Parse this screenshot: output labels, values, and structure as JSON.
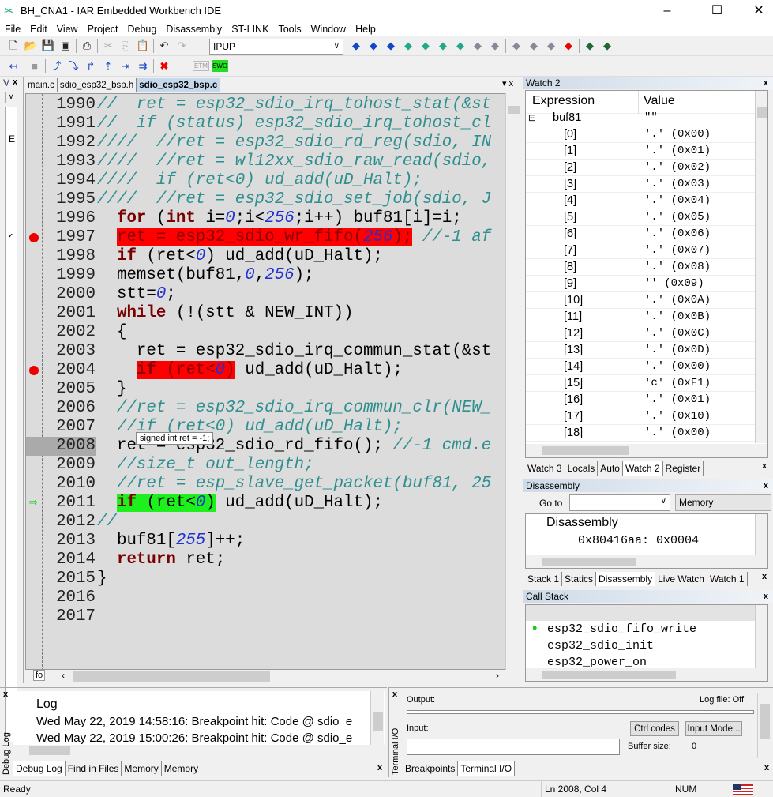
{
  "window": {
    "title": "BH_CNA1 - IAR Embedded Workbench IDE",
    "minimize": "–",
    "maximize": "☐",
    "close": "✕"
  },
  "menu": [
    "File",
    "Edit",
    "View",
    "Project",
    "Debug",
    "Disassembly",
    "ST-LINK",
    "Tools",
    "Window",
    "Help"
  ],
  "toolbar": {
    "configuration": "IPUP",
    "icons1": [
      "new-file",
      "open",
      "save",
      "save-all",
      "print",
      "cut",
      "copy",
      "paste",
      "undo",
      "redo"
    ],
    "icons2": [
      "toggle-breakpoint",
      "find-next",
      "find-prev",
      "go-to-bookmark",
      "template",
      "make",
      "debug-download",
      "debug-without-download",
      "stop-build",
      "step-into-disasm",
      "step-out-disasm",
      "breakpoint-remove",
      "breakpoint",
      "run-to-cursor",
      "go"
    ],
    "debug_icons": [
      "reset",
      "break",
      "step-over",
      "step-into",
      "step-out",
      "next-statement",
      "run-to-cursor",
      "go",
      "stop-debugging"
    ],
    "etm_label": "ETM",
    "swo_label": "SWO"
  },
  "left_pane": {
    "title": "V",
    "close": "x"
  },
  "editor": {
    "tabs": [
      {
        "label": "main.c",
        "active": false
      },
      {
        "label": "sdio_esp32_bsp.h",
        "active": false
      },
      {
        "label": "sdio_esp32_bsp.c",
        "active": true
      }
    ],
    "tab_menu": "▾ x",
    "function_box": "fo",
    "current_line": 2008,
    "tooltip": "signed int ret = -1;",
    "lines": [
      {
        "n": "1990",
        "tokens": [
          {
            "t": "//  ret = esp32_sdio_irq_tohost_stat(&st",
            "k": "cm"
          }
        ]
      },
      {
        "n": "1991",
        "tokens": [
          {
            "t": "//  if (status) esp32_sdio_irq_tohost_cl",
            "k": "cm"
          }
        ]
      },
      {
        "n": "1992",
        "tokens": [
          {
            "t": "////  //ret = esp32_sdio_rd_reg(sdio, IN",
            "k": "cm"
          }
        ]
      },
      {
        "n": "1993",
        "tokens": [
          {
            "t": "////  //ret = wl12xx_sdio_raw_read(sdio,",
            "k": "cm"
          }
        ]
      },
      {
        "n": "1994",
        "tokens": [
          {
            "t": "////  if (ret<0) ud_add(uD_Halt);",
            "k": "cm"
          }
        ]
      },
      {
        "n": "1995",
        "tokens": [
          {
            "t": "////  //ret = esp32_sdio_set_job(sdio, J",
            "k": "cm"
          }
        ]
      },
      {
        "n": "1996",
        "tokens": [
          {
            "t": "  "
          },
          {
            "t": "for",
            "k": "kw"
          },
          {
            "t": " ("
          },
          {
            "t": "int",
            "k": "kw"
          },
          {
            "t": " i="
          },
          {
            "t": "0",
            "k": "num"
          },
          {
            "t": ";i<"
          },
          {
            "t": "256",
            "k": "num"
          },
          {
            "t": ";i++) buf81[i]=i;"
          }
        ]
      },
      {
        "n": "1997",
        "bp": true,
        "tokens": [
          {
            "t": "  "
          },
          {
            "t": "ret = esp32_sdio_wr_fifo(",
            "hl": "red"
          },
          {
            "t": "256",
            "k": "num",
            "hl": "red"
          },
          {
            "t": ");",
            "hl": "red"
          },
          {
            "t": " //-1 af",
            "k": "cm"
          }
        ]
      },
      {
        "n": "1998",
        "tokens": [
          {
            "t": "  "
          },
          {
            "t": "if",
            "k": "kw"
          },
          {
            "t": " (ret<"
          },
          {
            "t": "0",
            "k": "num"
          },
          {
            "t": ") ud_add(uD_Halt);"
          }
        ]
      },
      {
        "n": "1999",
        "tokens": [
          {
            "t": "  memset(buf81,"
          },
          {
            "t": "0",
            "k": "num"
          },
          {
            "t": ","
          },
          {
            "t": "256",
            "k": "num"
          },
          {
            "t": ");"
          }
        ]
      },
      {
        "n": "2000",
        "tokens": [
          {
            "t": "  stt="
          },
          {
            "t": "0",
            "k": "num"
          },
          {
            "t": ";"
          }
        ]
      },
      {
        "n": "2001",
        "tokens": [
          {
            "t": "  "
          },
          {
            "t": "while",
            "k": "kw"
          },
          {
            "t": " (!(stt & NEW_INT))"
          }
        ]
      },
      {
        "n": "2002",
        "tokens": [
          {
            "t": "  {"
          }
        ]
      },
      {
        "n": "2003",
        "tokens": [
          {
            "t": "    ret = esp32_sdio_irq_commun_stat(&st"
          }
        ]
      },
      {
        "n": "2004",
        "bp": true,
        "tokens": [
          {
            "t": "    "
          },
          {
            "t": "if",
            "k": "kw",
            "hl": "red"
          },
          {
            "t": " (ret<",
            "hl": "red"
          },
          {
            "t": "0",
            "k": "num",
            "hl": "red"
          },
          {
            "t": ")",
            "hl": "red"
          },
          {
            "t": " ud_add(uD_Halt);"
          }
        ]
      },
      {
        "n": "2005",
        "tokens": [
          {
            "t": "  }"
          }
        ]
      },
      {
        "n": "2006",
        "tokens": [
          {
            "t": "  "
          },
          {
            "t": "//ret = esp32_sdio_irq_commun_clr(NEW_",
            "k": "cm"
          }
        ]
      },
      {
        "n": "2007",
        "tokens": [
          {
            "t": "  "
          },
          {
            "t": "//if (ret<0) ud_add(uD_Halt);",
            "k": "cm"
          }
        ]
      },
      {
        "n": "2008",
        "tokens": [
          {
            "t": "  ret = esp32_sdio_rd_fifo(); "
          },
          {
            "t": "//-1 cmd.e",
            "k": "cm"
          }
        ]
      },
      {
        "n": "2009",
        "tokens": [
          {
            "t": "  "
          },
          {
            "t": "//size_t out_length;",
            "k": "cm"
          }
        ]
      },
      {
        "n": "2010",
        "tokens": [
          {
            "t": "  "
          },
          {
            "t": "//ret = esp_slave_get_packet(buf81, 25",
            "k": "cm"
          }
        ]
      },
      {
        "n": "2011",
        "pc": true,
        "tokens": [
          {
            "t": "  "
          },
          {
            "t": "if",
            "k": "kw",
            "hl": "green"
          },
          {
            "t": " (ret<",
            "hl": "green"
          },
          {
            "t": "0",
            "k": "num",
            "hl": "green"
          },
          {
            "t": ")",
            "hl": "green"
          },
          {
            "t": " ud_add(uD_Halt);"
          }
        ]
      },
      {
        "n": "2012",
        "tokens": [
          {
            "t": "//",
            "k": "cm"
          }
        ]
      },
      {
        "n": "2013",
        "tokens": [
          {
            "t": "  buf81["
          },
          {
            "t": "255",
            "k": "num"
          },
          {
            "t": "]++;"
          }
        ]
      },
      {
        "n": "2014",
        "tokens": [
          {
            "t": "  "
          },
          {
            "t": "return",
            "k": "kw"
          },
          {
            "t": " ret;"
          }
        ]
      },
      {
        "n": "2015",
        "tokens": [
          {
            "t": "}"
          }
        ]
      },
      {
        "n": "2016",
        "tokens": []
      },
      {
        "n": "2017",
        "tokens": []
      }
    ]
  },
  "watch": {
    "title": "Watch 2",
    "columns": [
      "Expression",
      "Value"
    ],
    "rows": [
      {
        "expr": "buf81",
        "value": "\"\"",
        "root": true
      },
      {
        "expr": "[0]",
        "value": "'.'  (0x00)"
      },
      {
        "expr": "[1]",
        "value": "'.'  (0x01)"
      },
      {
        "expr": "[2]",
        "value": "'.'  (0x02)"
      },
      {
        "expr": "[3]",
        "value": "'.'  (0x03)"
      },
      {
        "expr": "[4]",
        "value": "'.'  (0x04)"
      },
      {
        "expr": "[5]",
        "value": "'.'  (0x05)"
      },
      {
        "expr": "[6]",
        "value": "'.'  (0x06)"
      },
      {
        "expr": "[7]",
        "value": "'.'  (0x07)"
      },
      {
        "expr": "[8]",
        "value": "'.'  (0x08)"
      },
      {
        "expr": "[9]",
        "value": "''  (0x09)"
      },
      {
        "expr": "[10]",
        "value": "'.'  (0x0A)"
      },
      {
        "expr": "[11]",
        "value": "'.'  (0x0B)"
      },
      {
        "expr": "[12]",
        "value": "'.'  (0x0C)"
      },
      {
        "expr": "[13]",
        "value": "'.'  (0x0D)"
      },
      {
        "expr": "[14]",
        "value": "'.'  (0x00)"
      },
      {
        "expr": "[15]",
        "value": "'c'  (0xF1)"
      },
      {
        "expr": "[16]",
        "value": "'.'  (0x01)"
      },
      {
        "expr": "[17]",
        "value": "'.'  (0x10)"
      },
      {
        "expr": "[18]",
        "value": "'.'  (0x00)"
      }
    ],
    "tabs": [
      {
        "label": "Watch 3"
      },
      {
        "label": "Locals"
      },
      {
        "label": "Auto"
      },
      {
        "label": "Watch 2",
        "active": true
      },
      {
        "label": "Register"
      }
    ]
  },
  "disassembly": {
    "title": "Disassembly",
    "goto_label": "Go to",
    "goto_value": "",
    "memory_select": "Memory",
    "heading": "Disassembly",
    "line": "0x80416aa: 0x0004",
    "tabs": [
      {
        "label": "Stack 1"
      },
      {
        "label": "Statics"
      },
      {
        "label": "Disassembly",
        "active": true
      },
      {
        "label": "Live Watch"
      },
      {
        "label": "Watch 1"
      }
    ]
  },
  "callstack": {
    "title": "Call Stack",
    "items": [
      {
        "label": "esp32_sdio_fifo_write",
        "current": true
      },
      {
        "label": "esp32_sdio_init"
      },
      {
        "label": "esp32_power_on"
      }
    ]
  },
  "debug_log": {
    "side_label": "Debug Log",
    "heading": "Log",
    "entries": [
      "Wed May 22, 2019 14:58:16: Breakpoint hit: Code @ sdio_e",
      "Wed May 22, 2019 15:00:26: Breakpoint hit: Code @ sdio_e"
    ],
    "tabs": [
      {
        "label": "Debug Log",
        "active": true
      },
      {
        "label": "Find in Files"
      },
      {
        "label": "Memory"
      },
      {
        "label": "Memory"
      }
    ]
  },
  "terminal": {
    "side_label": "Terminal I/O",
    "output_label": "Output:",
    "log_file": "Log file: Off",
    "input_label": "Input:",
    "input_value": "",
    "ctrl_codes": "Ctrl codes",
    "input_mode": "Input Mode...",
    "buffer_label": "Buffer size:",
    "buffer_value": "0",
    "tabs": [
      {
        "label": "Breakpoints"
      },
      {
        "label": "Terminal I/O",
        "active": true
      }
    ]
  },
  "status": {
    "text": "Ready",
    "position": "Ln 2008, Col 4",
    "num": "NUM"
  },
  "colors": {
    "breakpoint": "#ff0000",
    "current_statement": "#1ef01e",
    "keyword": "#7a0000",
    "comment": "#2e8f8f",
    "number": "#2030d0"
  }
}
